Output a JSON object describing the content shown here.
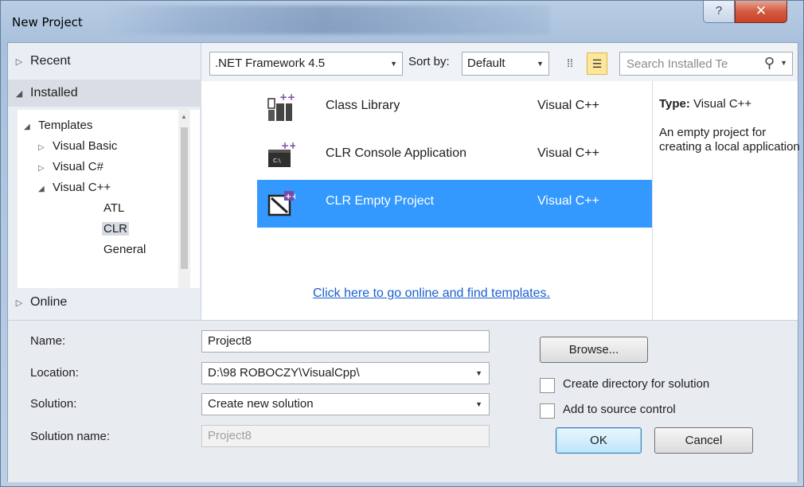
{
  "window": {
    "title": "New Project",
    "help_glyph": "?",
    "close_glyph": "✕"
  },
  "left_panel": {
    "recent": "Recent",
    "installed": "Installed",
    "templates": "Templates",
    "tree": [
      "Visual Basic",
      "Visual C#",
      "Visual C++",
      "ATL",
      "CLR",
      "General"
    ],
    "online": "Online"
  },
  "toolbar": {
    "framework": ".NET Framework 4.5",
    "sort_label": "Sort by:",
    "sort_value": "Default",
    "search_placeholder": "Search Installed Te"
  },
  "templates": [
    {
      "name": "Class Library",
      "language": "Visual C++",
      "selected": false
    },
    {
      "name": "CLR Console Application",
      "language": "Visual C++",
      "selected": false
    },
    {
      "name": "CLR Empty Project",
      "language": "Visual C++",
      "selected": true
    }
  ],
  "online_link": "Click here to go online and find templates.",
  "description": {
    "type_label": "Type:",
    "type_value": "Visual C++",
    "text": "An empty project for creating a local application"
  },
  "form": {
    "name_label": "Name:",
    "name_value": "Project8",
    "location_label": "Location:",
    "location_value": "D:\\98 ROBOCZY\\VisualCpp\\",
    "solution_label": "Solution:",
    "solution_value": "Create new solution",
    "solution_name_label": "Solution name:",
    "solution_name_value": "Project8",
    "browse": "Browse...",
    "create_dir": "Create directory for solution",
    "create_dir_checked": false,
    "source_control": "Add to source control",
    "source_control_checked": false,
    "ok": "OK",
    "cancel": "Cancel"
  },
  "colors": {
    "selection": "#3399ff",
    "link": "#1a5fcf",
    "close_button": "#c7432a"
  }
}
